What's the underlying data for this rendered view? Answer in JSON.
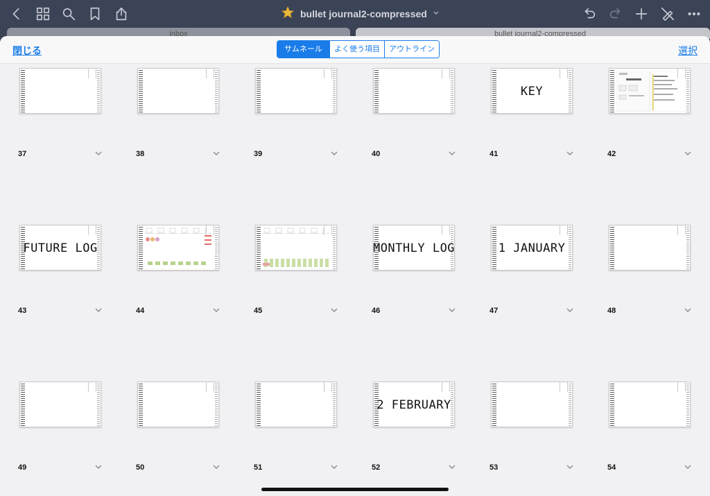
{
  "topbar": {
    "title": "bullet journal2-compressed",
    "icons": [
      "back-icon",
      "grid-icon",
      "search-icon",
      "bookmark-icon",
      "share-icon",
      "undo-icon",
      "redo-icon",
      "plus-icon",
      "pen-off-icon",
      "more-icon"
    ]
  },
  "background_tabs": {
    "left": "inbox",
    "right": "bullet journal2-compressed"
  },
  "sheet": {
    "close_label": "閉じる",
    "select_label": "選択",
    "segments": [
      {
        "label": "サムネール",
        "active": true
      },
      {
        "label": "よく使う項目",
        "active": false
      },
      {
        "label": "アウトライン",
        "active": false
      }
    ]
  },
  "pages": [
    {
      "num": "37",
      "text": ""
    },
    {
      "num": "38",
      "text": ""
    },
    {
      "num": "39",
      "text": ""
    },
    {
      "num": "40",
      "text": ""
    },
    {
      "num": "41",
      "text": "KEY"
    },
    {
      "num": "42",
      "text": ""
    },
    {
      "num": "43",
      "text": "FUTURE LOG"
    },
    {
      "num": "44",
      "text": ""
    },
    {
      "num": "45",
      "text": ""
    },
    {
      "num": "46",
      "text": "MONTHLY LOG"
    },
    {
      "num": "47",
      "text": "1 JANUARY"
    },
    {
      "num": "48",
      "text": ""
    },
    {
      "num": "49",
      "text": ""
    },
    {
      "num": "50",
      "text": ""
    },
    {
      "num": "51",
      "text": ""
    },
    {
      "num": "52",
      "text": "2 FEBRUARY"
    },
    {
      "num": "53",
      "text": ""
    },
    {
      "num": "54",
      "text": ""
    }
  ],
  "colors": {
    "accent": "#1a7ce8",
    "topbar": "#3b4356",
    "sheet": "#f1f1f3"
  }
}
